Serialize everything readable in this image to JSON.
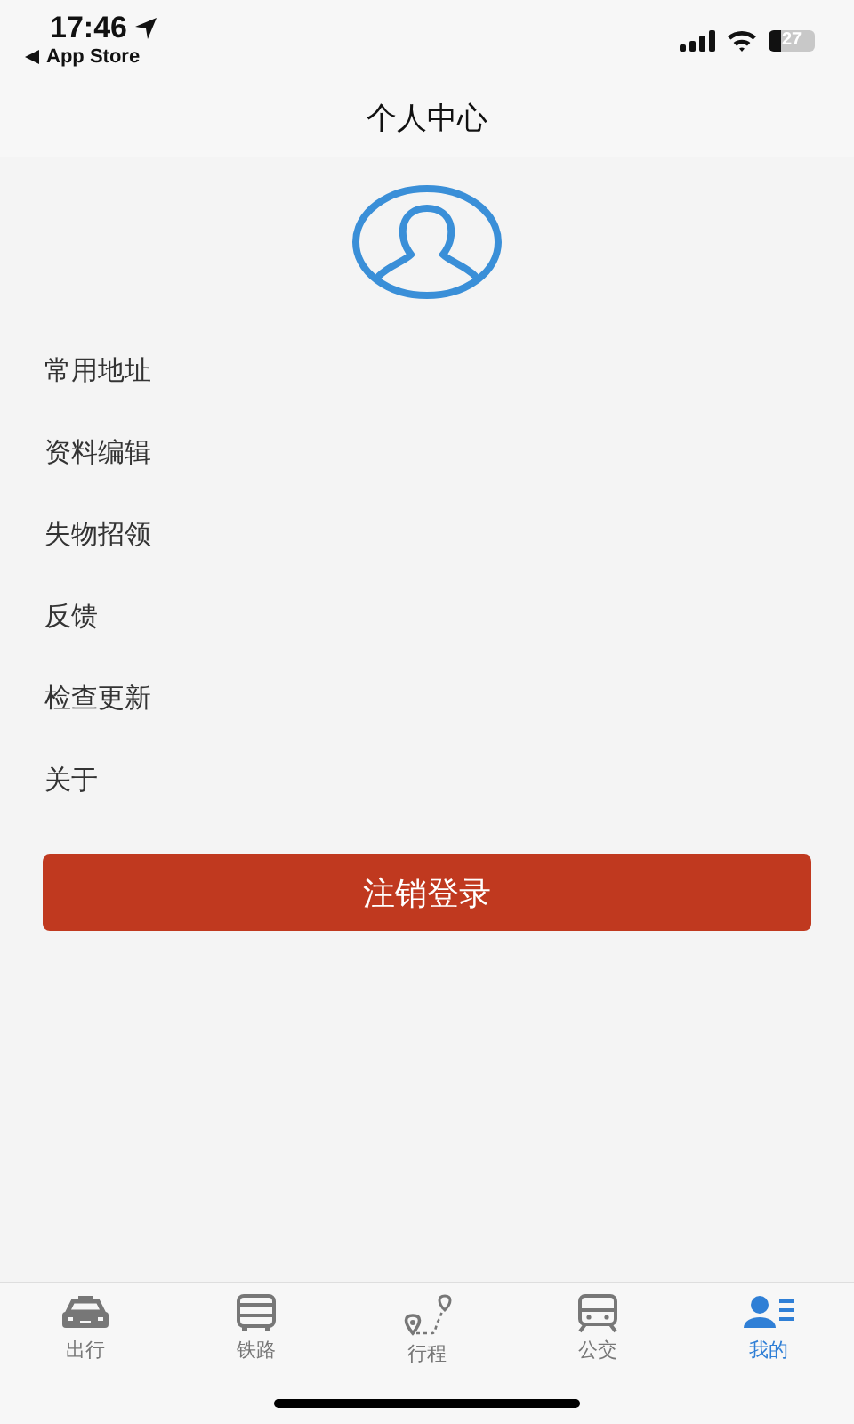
{
  "status_bar": {
    "time": "17:46",
    "back_label": "App Store",
    "battery": "27"
  },
  "header": {
    "title": "个人中心"
  },
  "menu": [
    "常用地址",
    "资料编辑",
    "失物招领",
    "反馈",
    "检查更新",
    "关于"
  ],
  "logout_button": "注销登录",
  "tab_bar": [
    {
      "kind": "taxi",
      "label": "出行",
      "selected": false
    },
    {
      "kind": "bus",
      "label": "铁路",
      "selected": false
    },
    {
      "kind": "route",
      "label": "行程",
      "selected": false
    },
    {
      "kind": "train",
      "label": "公交",
      "selected": false
    },
    {
      "kind": "profile",
      "label": "我的",
      "selected": true
    }
  ]
}
